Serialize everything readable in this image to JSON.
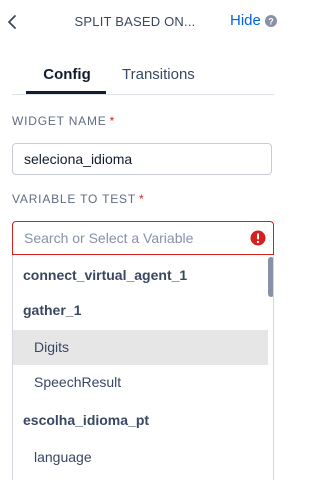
{
  "header": {
    "title": "SPLIT BASED ON...",
    "hide_label": "Hide",
    "icons": {
      "back": "chevron-left-icon",
      "help": "help-circle-icon"
    }
  },
  "tabs": [
    {
      "label": "Config",
      "selected": true
    },
    {
      "label": "Transitions",
      "selected": false
    }
  ],
  "widget_name": {
    "label": "WIDGET NAME",
    "required_mark": "*",
    "value": "seleciona_idioma"
  },
  "variable_to_test": {
    "label": "VARIABLE TO TEST",
    "required_mark": "*",
    "placeholder": "Search or Select a Variable",
    "value": "",
    "error_icon": "error-icon",
    "options": [
      {
        "text": "connect_virtual_agent_1",
        "type": "group"
      },
      {
        "text": "gather_1",
        "type": "group"
      },
      {
        "text": "Digits",
        "type": "item",
        "highlighted": true
      },
      {
        "text": "SpeechResult",
        "type": "item"
      },
      {
        "text": "escolha_idioma_pt",
        "type": "group"
      },
      {
        "text": "language",
        "type": "item"
      }
    ]
  },
  "colors": {
    "accent": "#0263e0",
    "error": "#d61f1f",
    "highlight": "#e6e6e6",
    "text": "#121c2d"
  }
}
